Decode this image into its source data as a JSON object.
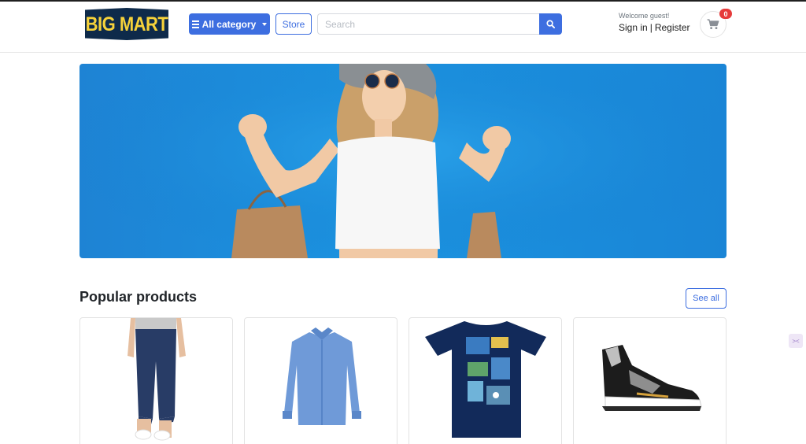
{
  "header": {
    "logo_text": "BIG MART",
    "category_button": "All category",
    "store_button": "Store",
    "search_placeholder": "Search",
    "welcome_text": "Welcome guest!",
    "sign_in": "Sign in",
    "separator": "|",
    "register": "Register",
    "cart_count": "0"
  },
  "banner": {
    "image": "woman-with-shopping-bags"
  },
  "popular": {
    "title": "Popular products",
    "see_all": "See all",
    "products": [
      {
        "image": "jeans"
      },
      {
        "image": "blue-shirt"
      },
      {
        "image": "navy-graphic-tshirt"
      },
      {
        "image": "sneaker"
      }
    ]
  },
  "colors": {
    "primary": "#3d6ee0",
    "badge": "#e63b3b",
    "logo_bg": "#0e2a4a",
    "logo_text": "#f6d23a",
    "banner_bg": "#1b8fdd"
  }
}
